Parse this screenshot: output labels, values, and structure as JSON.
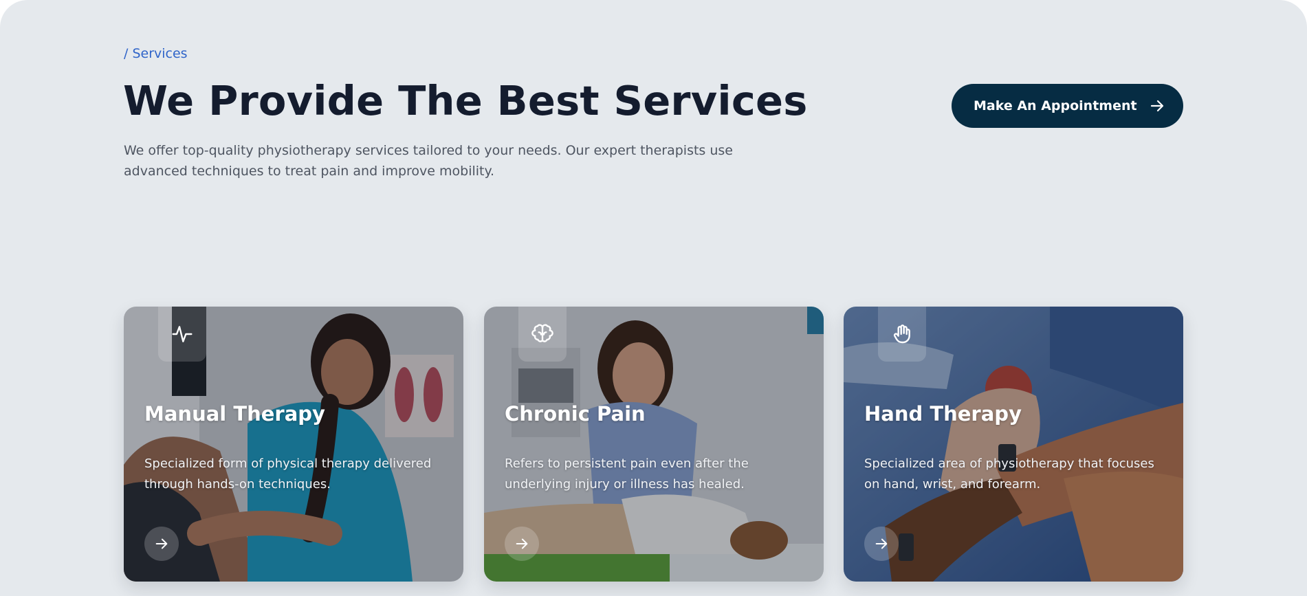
{
  "breadcrumb": "/ Services",
  "title": "We Provide The Best Services",
  "intro": "We offer top-quality physiotherapy services tailored to your needs. Our expert therapists use advanced techniques to treat pain and improve mobility.",
  "cta": {
    "label": "Make An Appointment",
    "icon": "arrow-right-icon"
  },
  "colors": {
    "background": "#e5e9ed",
    "breadcrumb": "#2f64c9",
    "title": "#141c2e",
    "cta_background": "#062c43"
  },
  "cards": [
    {
      "title": "Manual Therapy",
      "description": "Specialized form of physical therapy delivered through hands-on techniques.",
      "icon": "pulse-icon",
      "link_icon": "arrow-right-icon",
      "image": "therapist adjusting patient's shoulder in a clinic"
    },
    {
      "title": "Chronic Pain",
      "description": "Refers to persistent pain even after the underlying injury or illness has healed.",
      "icon": "brain-icon",
      "link_icon": "arrow-right-icon",
      "image": "therapist treating patient lying on a treatment table"
    },
    {
      "title": "Hand Therapy",
      "description": "Specialized area of physiotherapy that focuses on hand, wrist, and forearm.",
      "icon": "hand-icon",
      "link_icon": "arrow-right-icon",
      "image": "hands squeezing a therapy ball"
    }
  ]
}
